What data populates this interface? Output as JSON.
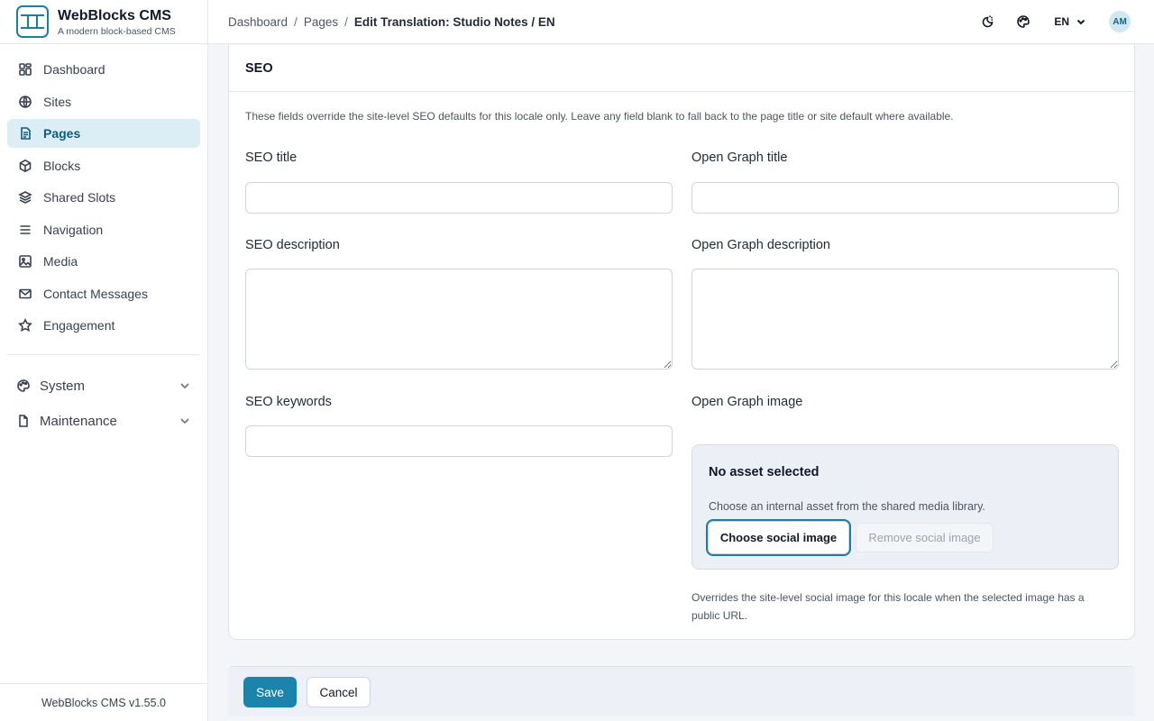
{
  "app": {
    "name": "WebBlocks CMS",
    "tagline": "A modern block-based CMS",
    "version": "WebBlocks CMS v1.55.0"
  },
  "sidebar": {
    "items": [
      {
        "label": "Dashboard",
        "icon": "dashboard-icon",
        "active": false
      },
      {
        "label": "Sites",
        "icon": "globe-icon",
        "active": false
      },
      {
        "label": "Pages",
        "icon": "page-icon",
        "active": true
      },
      {
        "label": "Blocks",
        "icon": "cube-icon",
        "active": false
      },
      {
        "label": "Shared Slots",
        "icon": "layers-icon",
        "active": false
      },
      {
        "label": "Navigation",
        "icon": "menu-icon",
        "active": false
      },
      {
        "label": "Media",
        "icon": "image-icon",
        "active": false
      },
      {
        "label": "Contact Messages",
        "icon": "mail-icon",
        "active": false
      },
      {
        "label": "Engagement",
        "icon": "star-icon",
        "active": false
      }
    ],
    "groups": [
      {
        "label": "System",
        "icon": "palette-icon"
      },
      {
        "label": "Maintenance",
        "icon": "file-icon"
      }
    ]
  },
  "header": {
    "breadcrumb": [
      "Dashboard",
      "Pages",
      "Edit Translation: Studio Notes / EN"
    ],
    "language": "EN",
    "avatar_initials": "AM"
  },
  "seo": {
    "title": "SEO",
    "hint": "These fields override the site-level SEO defaults for this locale only. Leave any field blank to fall back to the page title or site default where available.",
    "seo_title_label": "SEO title",
    "seo_title_value": "",
    "og_title_label": "Open Graph title",
    "og_title_value": "",
    "seo_description_label": "SEO description",
    "seo_description_value": "",
    "og_description_label": "Open Graph description",
    "og_description_value": "",
    "seo_keywords_label": "SEO keywords",
    "seo_keywords_value": "",
    "og_image_label": "Open Graph image",
    "asset_title": "No asset selected",
    "asset_desc": "Choose an internal asset from the shared media library.",
    "choose_label": "Choose social image",
    "remove_label": "Remove social image",
    "og_note": "Overrides the site-level social image for this locale when the selected image has a public URL."
  },
  "actions": {
    "save_label": "Save",
    "cancel_label": "Cancel"
  },
  "colors": {
    "accent": "#1b84ad",
    "active_bg": "#dbeef5",
    "active_text": "#0f5d7a"
  }
}
